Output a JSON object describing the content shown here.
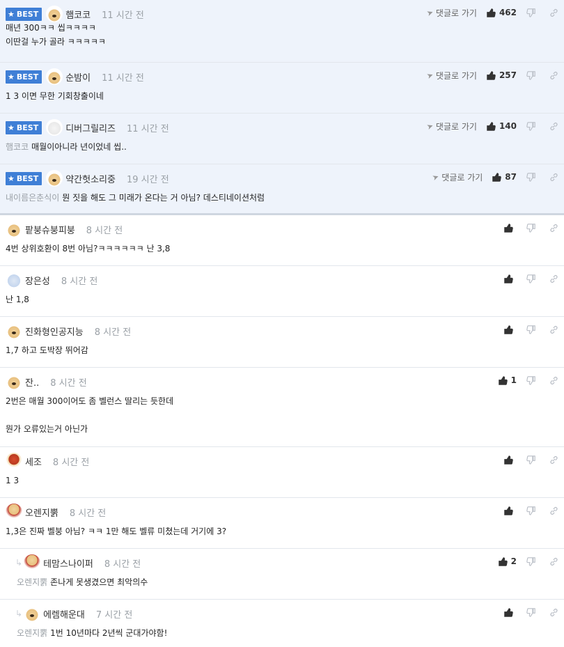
{
  "best_badge": "BEST",
  "goto_label": "댓글로 가기",
  "comments": [
    {
      "kind": "best",
      "nick": "햄코코",
      "time": "11 시간 전",
      "likes": "462",
      "mention": "",
      "text": "매년 300ㅋㅋ 씹ㅋㅋㅋㅋ\n이딴걸 누가 골라 ㅋㅋㅋㅋㅋ",
      "avatar": "dog"
    },
    {
      "kind": "best",
      "nick": "순밤이",
      "time": "11 시간 전",
      "likes": "257",
      "mention": "",
      "text": "1 3 이면 무한 기회창출이네",
      "avatar": "dog"
    },
    {
      "kind": "best",
      "nick": "디버그릴리즈",
      "time": "11 시간 전",
      "likes": "140",
      "mention": "햄코코",
      "text": "매월이아니라 년이었네 씹..",
      "avatar": "white"
    },
    {
      "kind": "best",
      "nick": "약간헛소리중",
      "time": "19 시간 전",
      "likes": "87",
      "mention": "내이름은춘식이",
      "text": "뭔 짓을 해도 그 미래가 온다는 거 아님? 데스티네이션처럼",
      "avatar": "dog"
    },
    {
      "kind": "normal",
      "nick": "팥붕슈붕피붕",
      "time": "8 시간 전",
      "likes": "",
      "mention": "",
      "text": "4번 상위호환이 8번 아님?ㅋㅋㅋㅋㅋㅋ 난 3,8",
      "avatar": "dog"
    },
    {
      "kind": "normal",
      "nick": "장은성",
      "time": "8 시간 전",
      "likes": "",
      "mention": "",
      "text": "난 1,8",
      "avatar": "bear"
    },
    {
      "kind": "normal",
      "nick": "진화형인공지능",
      "time": "8 시간 전",
      "likes": "",
      "mention": "",
      "text": "1,7 하고 도박장 뛰어감",
      "avatar": "dog"
    },
    {
      "kind": "tall",
      "nick": "잔..",
      "time": "8 시간 전",
      "likes": "1",
      "mention": "",
      "text": "2번은 매월 300이어도 좀 벨런스 딸리는 듯한데\n\n뭔가 오류있는거 아닌가",
      "avatar": "dog"
    },
    {
      "kind": "normal",
      "nick": "세조",
      "time": "8 시간 전",
      "likes": "",
      "mention": "",
      "text": "1 3",
      "avatar": "red"
    },
    {
      "kind": "normal",
      "nick": "오렌지뿕",
      "time": "8 시간 전",
      "likes": "",
      "mention": "",
      "text": "1,3은 진짜 벨붕 아님? ㅋㅋ 1만 해도 벨류 미쳤는데 거기에 3?",
      "avatar": "dogred"
    },
    {
      "kind": "reply",
      "nick": "테맘스나이퍼",
      "time": "8 시간 전",
      "likes": "2",
      "mention": "오렌지뿕",
      "text": "존나게 못생겼으면 최악의수",
      "avatar": "dogred"
    },
    {
      "kind": "reply",
      "nick": "에렘해운대",
      "time": "7 시간 전",
      "likes": "",
      "mention": "오렌지뿕",
      "text": "1번 10년마다 2년씩 군대가야함!",
      "avatar": "dog"
    }
  ]
}
